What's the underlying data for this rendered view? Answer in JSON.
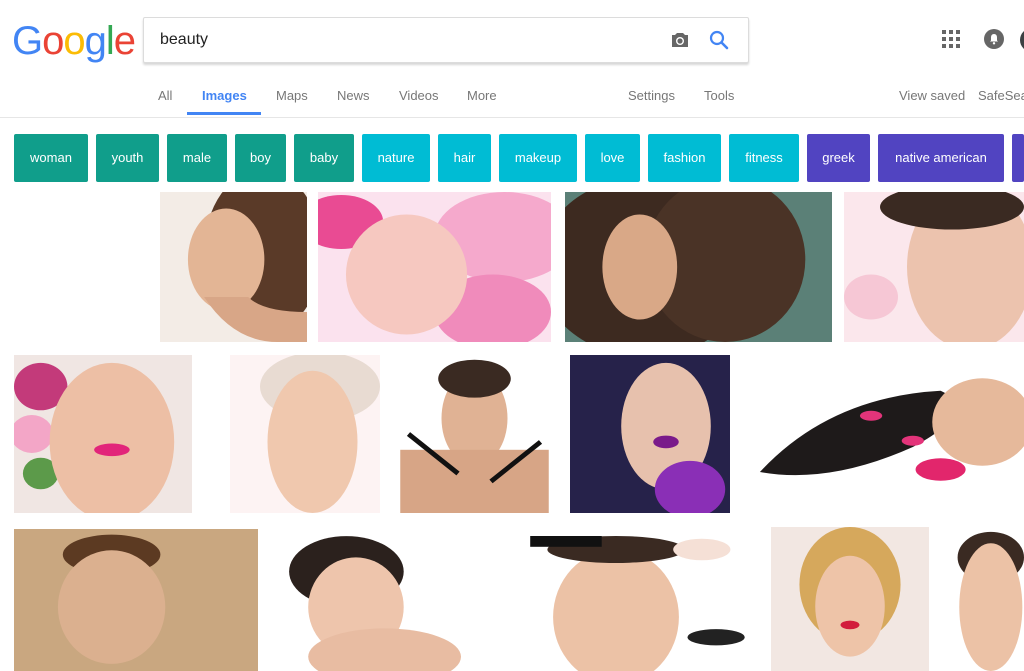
{
  "logo": {
    "letters": [
      "G",
      "o",
      "o",
      "g",
      "l",
      "e"
    ]
  },
  "search": {
    "value": "beauty"
  },
  "tabs": [
    "All",
    "Images",
    "Maps",
    "News",
    "Videos",
    "More"
  ],
  "tools": {
    "settings": "Settings",
    "tools": "Tools"
  },
  "right": {
    "view_saved": "View saved",
    "safesearch": "SafeSea"
  },
  "chips": [
    "woman",
    "youth",
    "male",
    "boy",
    "baby",
    "nature",
    "hair",
    "makeup",
    "love",
    "fashion",
    "fitness",
    "greek",
    "native american"
  ],
  "colors": {
    "accent": "#4285f4",
    "chip_green": "#109e8b",
    "chip_cyan": "#00bcd4",
    "chip_purple": "#5144c1"
  },
  "icons": [
    "camera-icon",
    "search-icon",
    "apps-grid-icon",
    "notifications-icon",
    "account-avatar"
  ]
}
